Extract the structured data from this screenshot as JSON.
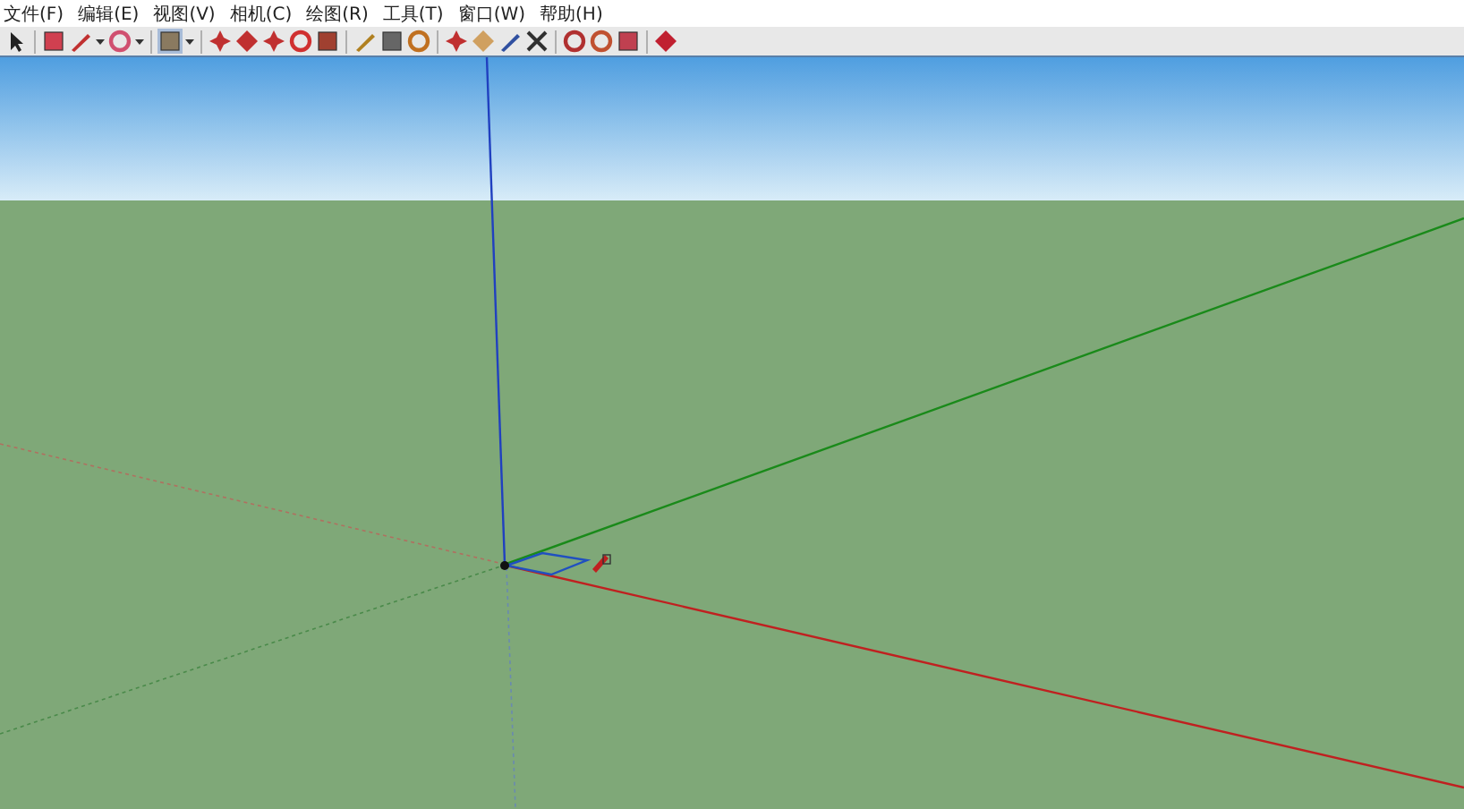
{
  "menu_bar": {
    "items": [
      {
        "label": "文件(F)"
      },
      {
        "label": "编辑(E)"
      },
      {
        "label": "视图(V)"
      },
      {
        "label": "相机(C)"
      },
      {
        "label": "绘图(R)"
      },
      {
        "label": "工具(T)"
      },
      {
        "label": "窗口(W)"
      },
      {
        "label": "帮助(H)"
      }
    ]
  }
}
